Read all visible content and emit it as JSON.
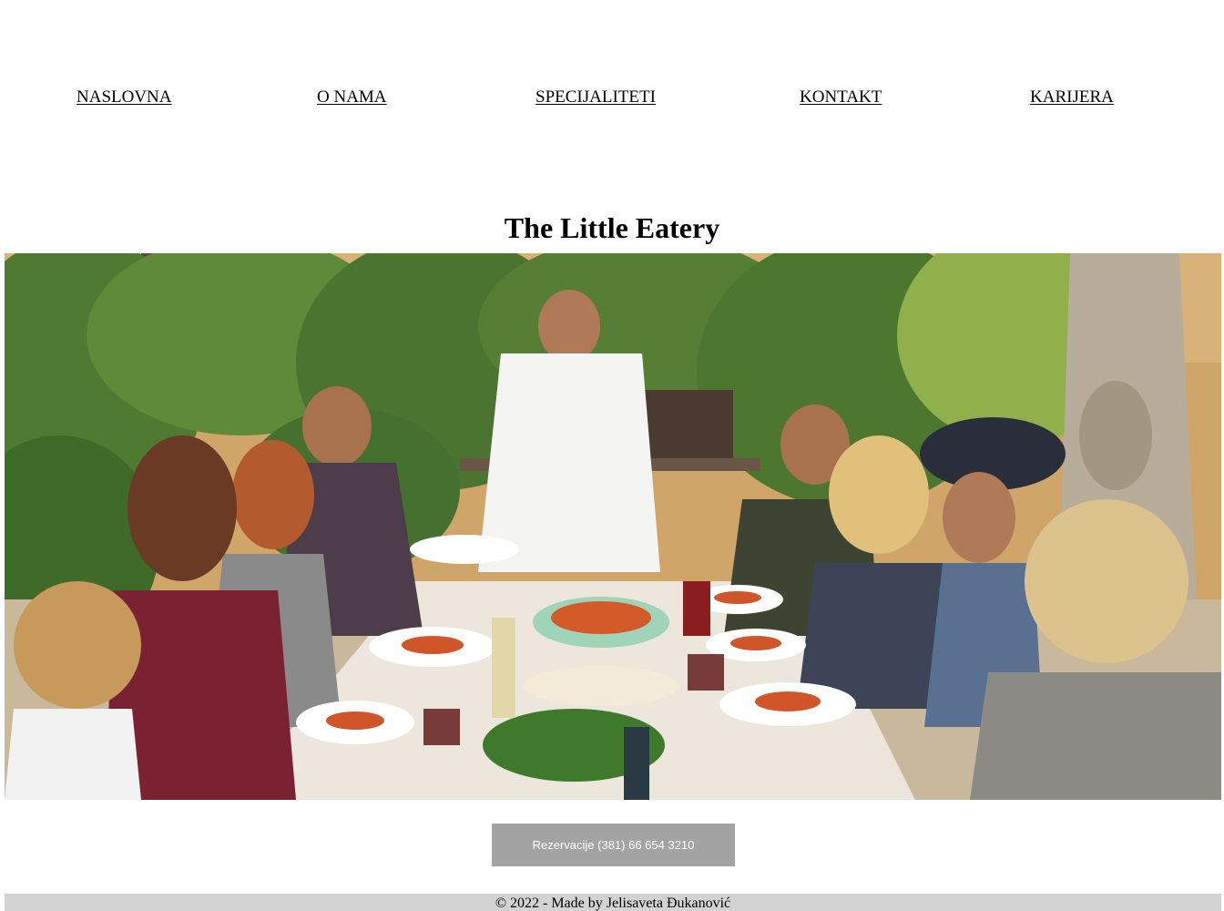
{
  "nav": {
    "items": [
      {
        "label": "NASLOVNA"
      },
      {
        "label": "O NAMA"
      },
      {
        "label": "SPECIJALITETI"
      },
      {
        "label": "KONTAKT"
      },
      {
        "label": "KARIJERA"
      }
    ]
  },
  "header": {
    "title": "The Little Eatery"
  },
  "hero": {
    "alt": "Friends sharing pasta at an outdoor garden table"
  },
  "reservation": {
    "label": "Rezervacije (381) 66 654 3210",
    "color": "#a3a3a3"
  },
  "footer": {
    "text": "© 2022 - Made by Jelisaveta Đukanović",
    "color": "#d3d3d3"
  }
}
